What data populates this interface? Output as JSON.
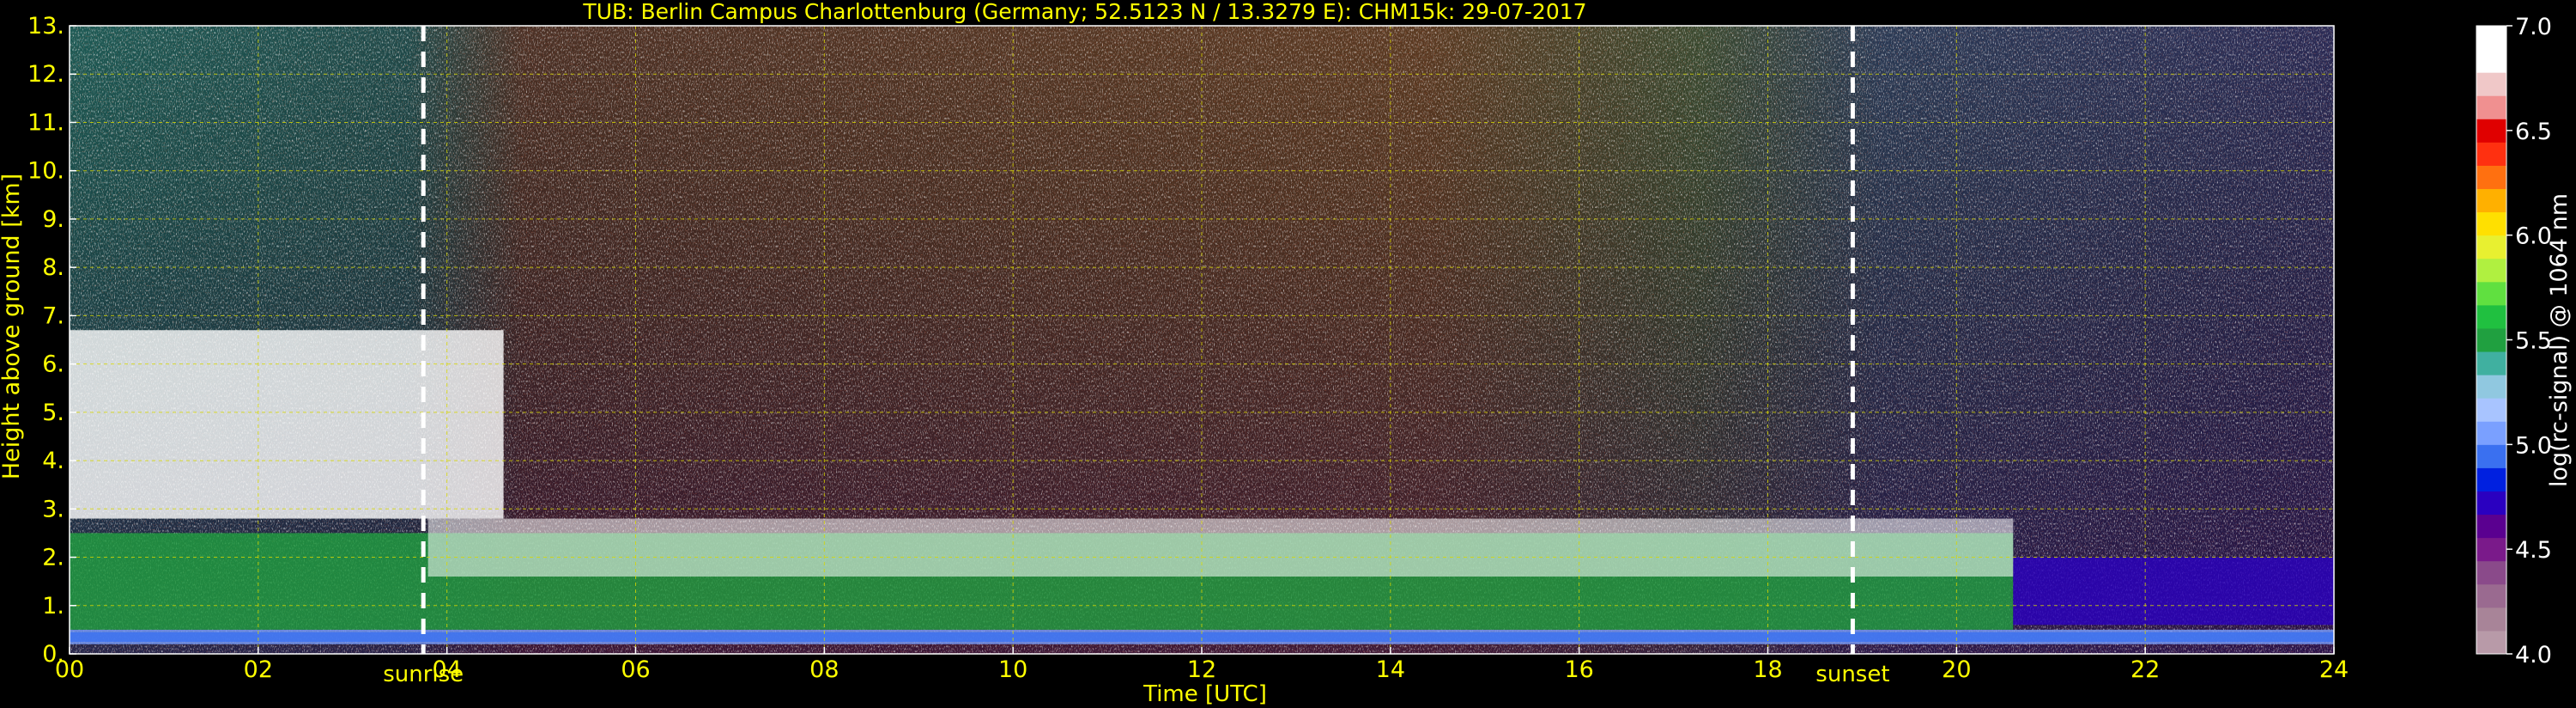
{
  "chart_data": {
    "type": "heatmap",
    "title": "TUB: Berlin Campus Charlottenburg (Germany; 52.5123 N / 13.3279 E):    CHM15k: 29-07-2017",
    "xlabel": "Time [UTC]",
    "ylabel": "Height above ground [km]",
    "xlim": [
      0,
      24
    ],
    "ylim": [
      0,
      13
    ],
    "x_ticks": [
      "00",
      "02",
      "04",
      "06",
      "08",
      "10",
      "12",
      "14",
      "16",
      "18",
      "20",
      "22",
      "24"
    ],
    "y_ticks": [
      "0.",
      "1.",
      "2.",
      "3.",
      "4.",
      "5.",
      "6.",
      "7.",
      "8.",
      "9.",
      "10.",
      "11.",
      "12.",
      "13."
    ],
    "grid": true,
    "annotations": [
      {
        "label": "sunrise",
        "time_h": 3.75
      },
      {
        "label": "sunset",
        "time_h": 18.9
      }
    ],
    "colorbar": {
      "label": "log(rc-signal) @ 1064 nm",
      "range": [
        4.0,
        7.0
      ],
      "ticks": [
        "4.0",
        "4.5",
        "5.0",
        "5.5",
        "6.0",
        "6.5",
        "7.0"
      ],
      "colors": [
        "#b89aa8",
        "#a88498",
        "#9a6a90",
        "#8a4a8a",
        "#7a1a8a",
        "#5a0090",
        "#2a00c0",
        "#0020e0",
        "#3a70f0",
        "#7aa0ff",
        "#a8c4ff",
        "#90c8e0",
        "#40b0a0",
        "#20a040",
        "#20c040",
        "#60e040",
        "#b0f040",
        "#e8f030",
        "#ffe000",
        "#ffb000",
        "#ff7010",
        "#ff3010",
        "#e00000",
        "#f09090",
        "#f0c8c8",
        "#ffffff",
        "#ffffff"
      ]
    },
    "layers": [
      {
        "name": "aerosol_surface_layer",
        "height_km": [
          0.2,
          0.5
        ],
        "time_h": [
          0,
          24
        ],
        "level": 5.0
      },
      {
        "name": "boundary_layer",
        "height_km": [
          0.5,
          2.5
        ],
        "time_h": [
          0,
          20.6
        ],
        "level": 5.5
      },
      {
        "name": "residual_layer_night",
        "height_km": [
          0.6,
          2.0
        ],
        "time_h": [
          20.6,
          24
        ],
        "level": 4.7
      },
      {
        "name": "cloud_layer_morning",
        "height_km": [
          2.8,
          6.7
        ],
        "time_h": [
          0,
          4.6
        ],
        "level": 6.8
      },
      {
        "name": "boundary_layer_top_clouds",
        "height_km": [
          1.6,
          2.8
        ],
        "time_h": [
          3.8,
          20.6
        ],
        "level": 7.0
      }
    ]
  }
}
